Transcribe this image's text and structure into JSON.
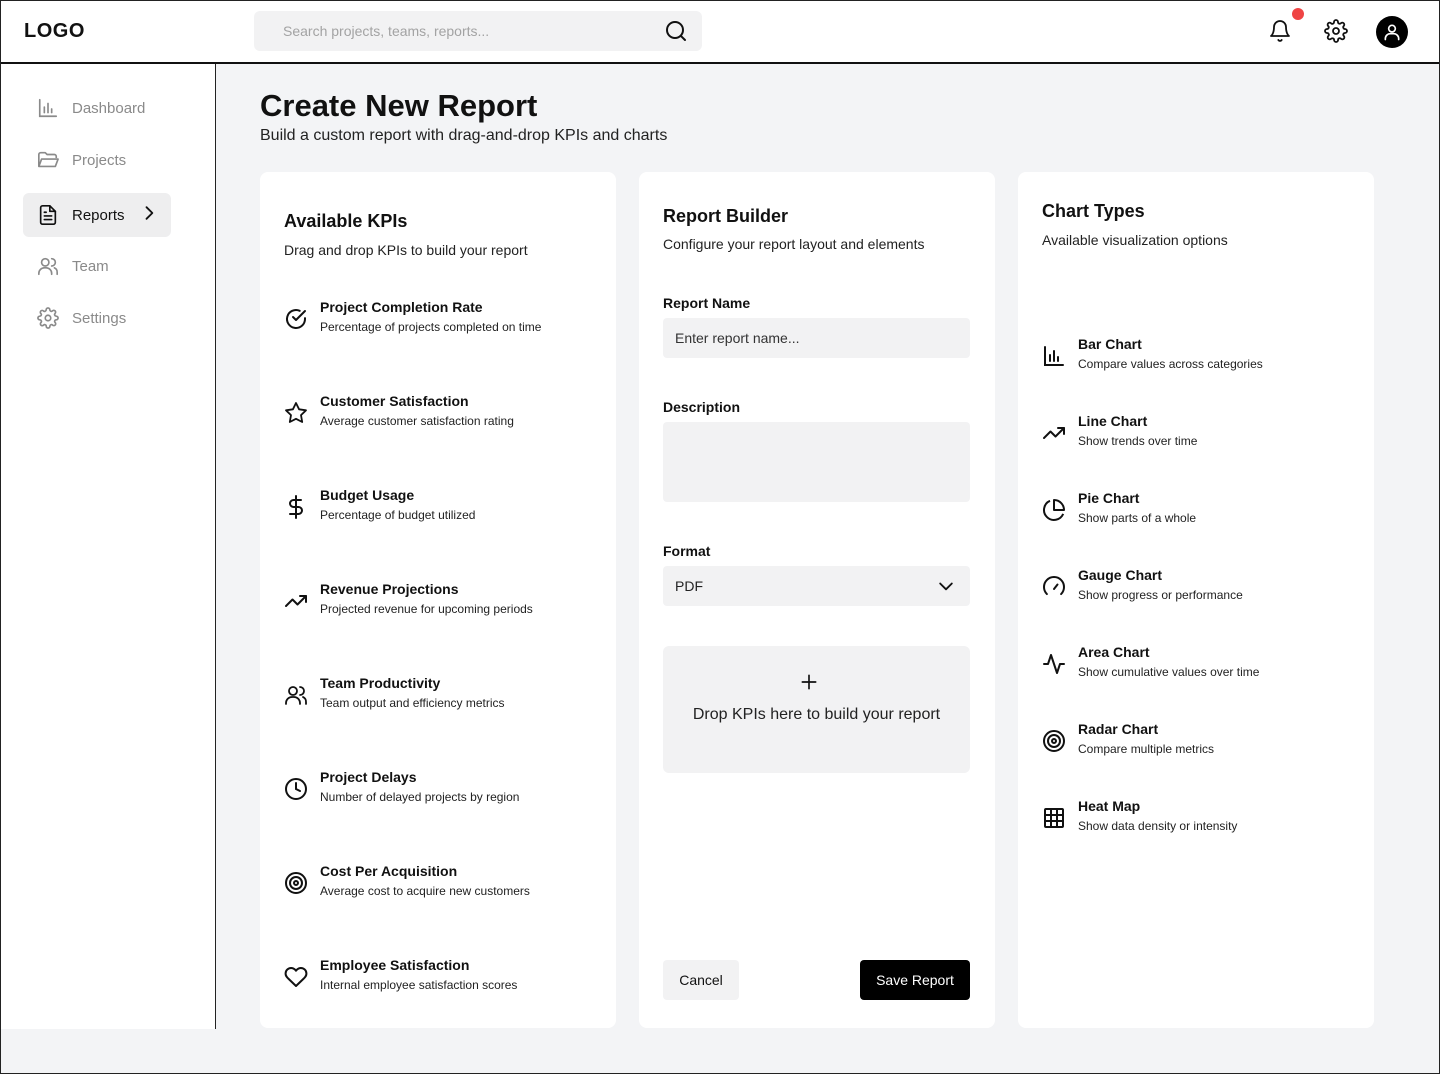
{
  "header": {
    "logo": "LOGO",
    "search_placeholder": "Search projects, teams, reports..."
  },
  "sidebar": {
    "items": [
      {
        "label": "Dashboard",
        "icon": "bar-chart-icon"
      },
      {
        "label": "Projects",
        "icon": "folder-icon"
      },
      {
        "label": "Reports",
        "icon": "document-icon",
        "active": true
      },
      {
        "label": "Team",
        "icon": "users-icon"
      },
      {
        "label": "Settings",
        "icon": "gear-icon"
      }
    ]
  },
  "page": {
    "title": "Create New Report",
    "subtitle": "Build a custom report with drag-and-drop KPIs and charts"
  },
  "kpis": {
    "title": "Available KPIs",
    "subtitle": "Drag and drop KPIs to build your report",
    "items": [
      {
        "title": "Project Completion Rate",
        "desc": "Percentage of projects completed on time",
        "icon": "check-circle-icon"
      },
      {
        "title": "Customer Satisfaction",
        "desc": "Average customer satisfaction rating",
        "icon": "star-icon"
      },
      {
        "title": "Budget Usage",
        "desc": "Percentage of budget utilized",
        "icon": "dollar-icon"
      },
      {
        "title": "Revenue Projections",
        "desc": "Projected revenue for upcoming periods",
        "icon": "trending-up-icon"
      },
      {
        "title": "Team Productivity",
        "desc": "Team output and efficiency metrics",
        "icon": "users-icon"
      },
      {
        "title": "Project Delays",
        "desc": "Number of delayed projects by region",
        "icon": "clock-icon"
      },
      {
        "title": "Cost Per Acquisition",
        "desc": "Average cost to acquire new customers",
        "icon": "target-icon"
      },
      {
        "title": "Employee Satisfaction",
        "desc": "Internal employee satisfaction scores",
        "icon": "heart-icon"
      }
    ]
  },
  "builder": {
    "title": "Report Builder",
    "subtitle": "Configure your report layout and elements",
    "name_label": "Report Name",
    "name_placeholder": "Enter report name...",
    "description_label": "Description",
    "description_value": "",
    "format_label": "Format",
    "format_value": "PDF",
    "dropzone_text": "Drop KPIs here to build your report",
    "cancel_label": "Cancel",
    "save_label": "Save Report"
  },
  "charts": {
    "title": "Chart Types",
    "subtitle": "Available visualization options",
    "items": [
      {
        "title": "Bar Chart",
        "desc": "Compare values across categories",
        "icon": "bar-chart-icon"
      },
      {
        "title": "Line Chart",
        "desc": "Show trends over time",
        "icon": "trending-up-icon"
      },
      {
        "title": "Pie Chart",
        "desc": "Show parts of a whole",
        "icon": "pie-chart-icon"
      },
      {
        "title": "Gauge Chart",
        "desc": "Show progress or performance",
        "icon": "gauge-icon"
      },
      {
        "title": "Area Chart",
        "desc": "Show cumulative values over time",
        "icon": "activity-icon"
      },
      {
        "title": "Radar Chart",
        "desc": "Compare multiple metrics",
        "icon": "target-icon"
      },
      {
        "title": "Heat Map",
        "desc": "Show data density or intensity",
        "icon": "grid-icon"
      }
    ]
  },
  "colors": {
    "accent": "#000000",
    "notification": "#ef4444",
    "background": "#f3f4f6"
  }
}
